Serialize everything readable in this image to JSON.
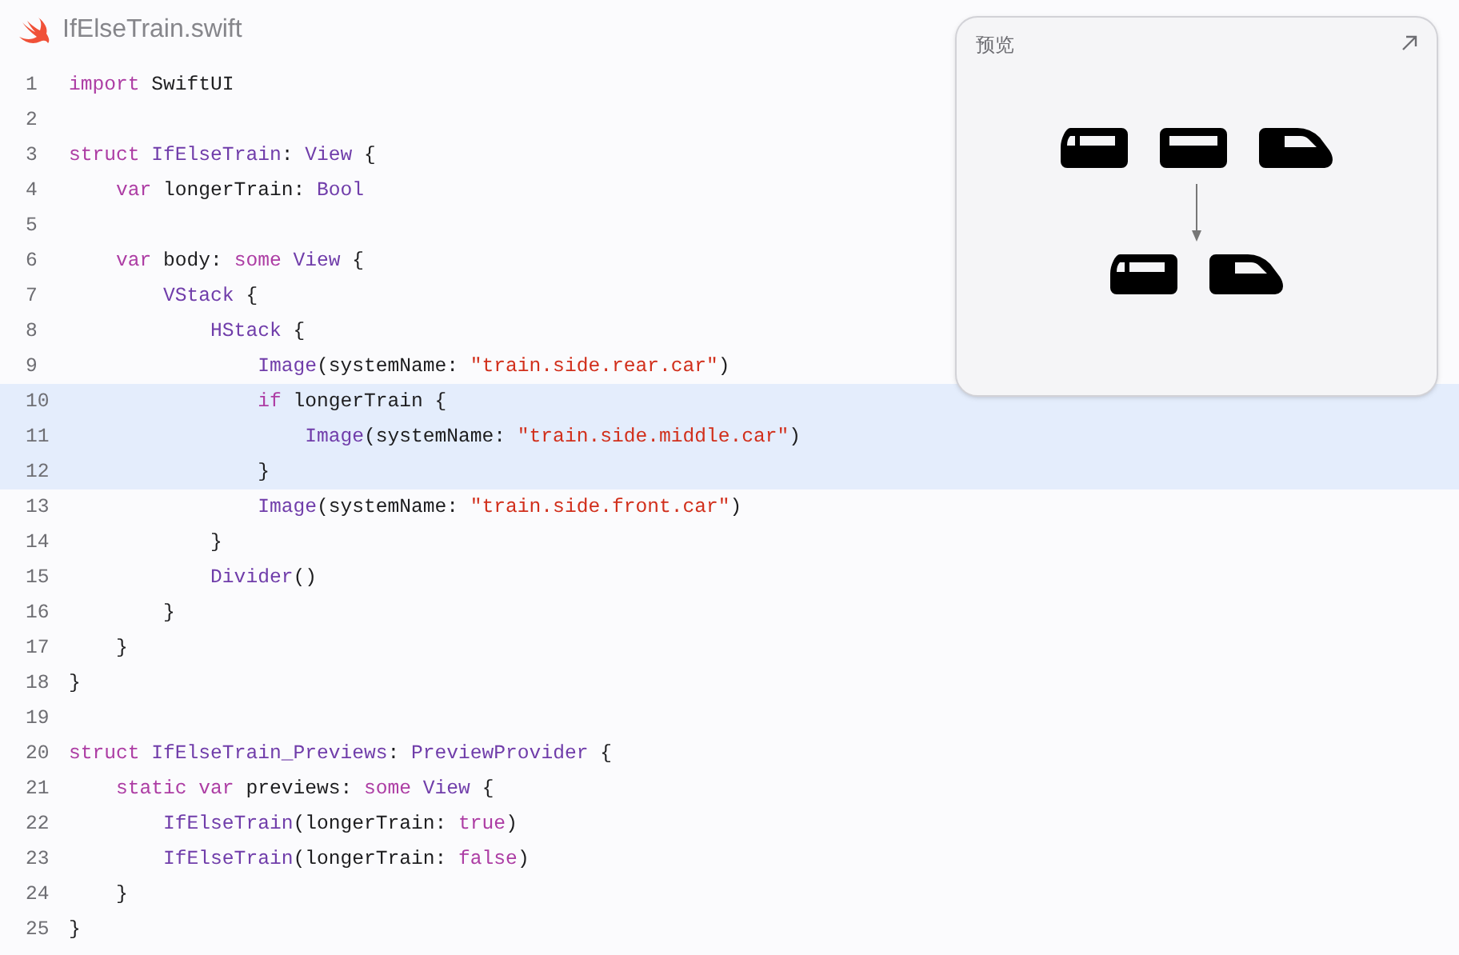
{
  "file": {
    "name": "IfElseTrain.swift"
  },
  "preview": {
    "title": "预览"
  },
  "lines": [
    {
      "number": "1",
      "highlighted": false,
      "tokens": [
        {
          "text": "import",
          "kind": "keyword"
        },
        {
          "text": " SwiftUI",
          "kind": "plain"
        }
      ]
    },
    {
      "number": "2",
      "highlighted": false
    },
    {
      "number": "3",
      "highlighted": false,
      "tokens": [
        {
          "text": "struct",
          "kind": "keyword"
        },
        {
          "text": " IfElseTrain",
          "kind": "type"
        },
        {
          "text": ": ",
          "kind": "plain"
        },
        {
          "text": "View",
          "kind": "type"
        },
        {
          "text": " {",
          "kind": "plain"
        }
      ]
    },
    {
      "number": "4",
      "highlighted": false,
      "tokens": [
        {
          "text": "    var",
          "kind": "keyword"
        },
        {
          "text": " longerTrain: ",
          "kind": "plain"
        },
        {
          "text": "Bool",
          "kind": "type"
        }
      ]
    },
    {
      "number": "5",
      "highlighted": false
    },
    {
      "number": "6",
      "highlighted": false,
      "tokens": [
        {
          "text": "    var",
          "kind": "keyword"
        },
        {
          "text": " body: ",
          "kind": "plain"
        },
        {
          "text": "some",
          "kind": "keyword"
        },
        {
          "text": " View",
          "kind": "type"
        },
        {
          "text": " {",
          "kind": "plain"
        }
      ]
    },
    {
      "number": "7",
      "highlighted": false,
      "tokens": [
        {
          "text": "        VStack",
          "kind": "type"
        },
        {
          "text": " {",
          "kind": "plain"
        }
      ]
    },
    {
      "number": "8",
      "highlighted": false,
      "tokens": [
        {
          "text": "            HStack",
          "kind": "type"
        },
        {
          "text": " {",
          "kind": "plain"
        }
      ]
    },
    {
      "number": "9",
      "highlighted": false,
      "tokens": [
        {
          "text": "                Image",
          "kind": "type"
        },
        {
          "text": "(systemName: ",
          "kind": "plain"
        },
        {
          "text": "\"train.side.rear.car\"",
          "kind": "string"
        },
        {
          "text": ")",
          "kind": "plain"
        }
      ]
    },
    {
      "number": "10",
      "highlighted": true,
      "tokens": [
        {
          "text": "                if",
          "kind": "keyword"
        },
        {
          "text": " longerTrain {",
          "kind": "plain"
        }
      ]
    },
    {
      "number": "11",
      "highlighted": true,
      "tokens": [
        {
          "text": "                    Image",
          "kind": "type"
        },
        {
          "text": "(systemName: ",
          "kind": "plain"
        },
        {
          "text": "\"train.side.middle.car\"",
          "kind": "string"
        },
        {
          "text": ")",
          "kind": "plain"
        }
      ]
    },
    {
      "number": "12",
      "highlighted": true,
      "tokens": [
        {
          "text": "                }",
          "kind": "plain"
        }
      ]
    },
    {
      "number": "13",
      "highlighted": false,
      "tokens": [
        {
          "text": "                Image",
          "kind": "type"
        },
        {
          "text": "(systemName: ",
          "kind": "plain"
        },
        {
          "text": "\"train.side.front.car\"",
          "kind": "string"
        },
        {
          "text": ")",
          "kind": "plain"
        }
      ]
    },
    {
      "number": "14",
      "highlighted": false,
      "tokens": [
        {
          "text": "            }",
          "kind": "plain"
        }
      ]
    },
    {
      "number": "15",
      "highlighted": false,
      "tokens": [
        {
          "text": "            Divider",
          "kind": "type"
        },
        {
          "text": "()",
          "kind": "plain"
        }
      ]
    },
    {
      "number": "16",
      "highlighted": false,
      "tokens": [
        {
          "text": "        }",
          "kind": "plain"
        }
      ]
    },
    {
      "number": "17",
      "highlighted": false,
      "tokens": [
        {
          "text": "    }",
          "kind": "plain"
        }
      ]
    },
    {
      "number": "18",
      "highlighted": false,
      "tokens": [
        {
          "text": "}",
          "kind": "plain"
        }
      ]
    },
    {
      "number": "19",
      "highlighted": false
    },
    {
      "number": "20",
      "highlighted": false,
      "tokens": [
        {
          "text": "struct",
          "kind": "keyword"
        },
        {
          "text": " IfElseTrain_Previews",
          "kind": "type"
        },
        {
          "text": ": ",
          "kind": "plain"
        },
        {
          "text": "PreviewProvider",
          "kind": "type"
        },
        {
          "text": " {",
          "kind": "plain"
        }
      ]
    },
    {
      "number": "21",
      "highlighted": false,
      "tokens": [
        {
          "text": "    static var",
          "kind": "keyword"
        },
        {
          "text": " previews: ",
          "kind": "plain"
        },
        {
          "text": "some",
          "kind": "keyword"
        },
        {
          "text": " View",
          "kind": "type"
        },
        {
          "text": " {",
          "kind": "plain"
        }
      ]
    },
    {
      "number": "22",
      "highlighted": false,
      "tokens": [
        {
          "text": "        IfElseTrain",
          "kind": "type"
        },
        {
          "text": "(longerTrain: ",
          "kind": "plain"
        },
        {
          "text": "true",
          "kind": "keyword"
        },
        {
          "text": ")",
          "kind": "plain"
        }
      ]
    },
    {
      "number": "23",
      "highlighted": false,
      "tokens": [
        {
          "text": "        IfElseTrain",
          "kind": "type"
        },
        {
          "text": "(longerTrain: ",
          "kind": "plain"
        },
        {
          "text": "false",
          "kind": "keyword"
        },
        {
          "text": ")",
          "kind": "plain"
        }
      ]
    },
    {
      "number": "24",
      "highlighted": false,
      "tokens": [
        {
          "text": "    }",
          "kind": "plain"
        }
      ]
    },
    {
      "number": "25",
      "highlighted": false,
      "tokens": [
        {
          "text": "}",
          "kind": "plain"
        }
      ]
    }
  ]
}
